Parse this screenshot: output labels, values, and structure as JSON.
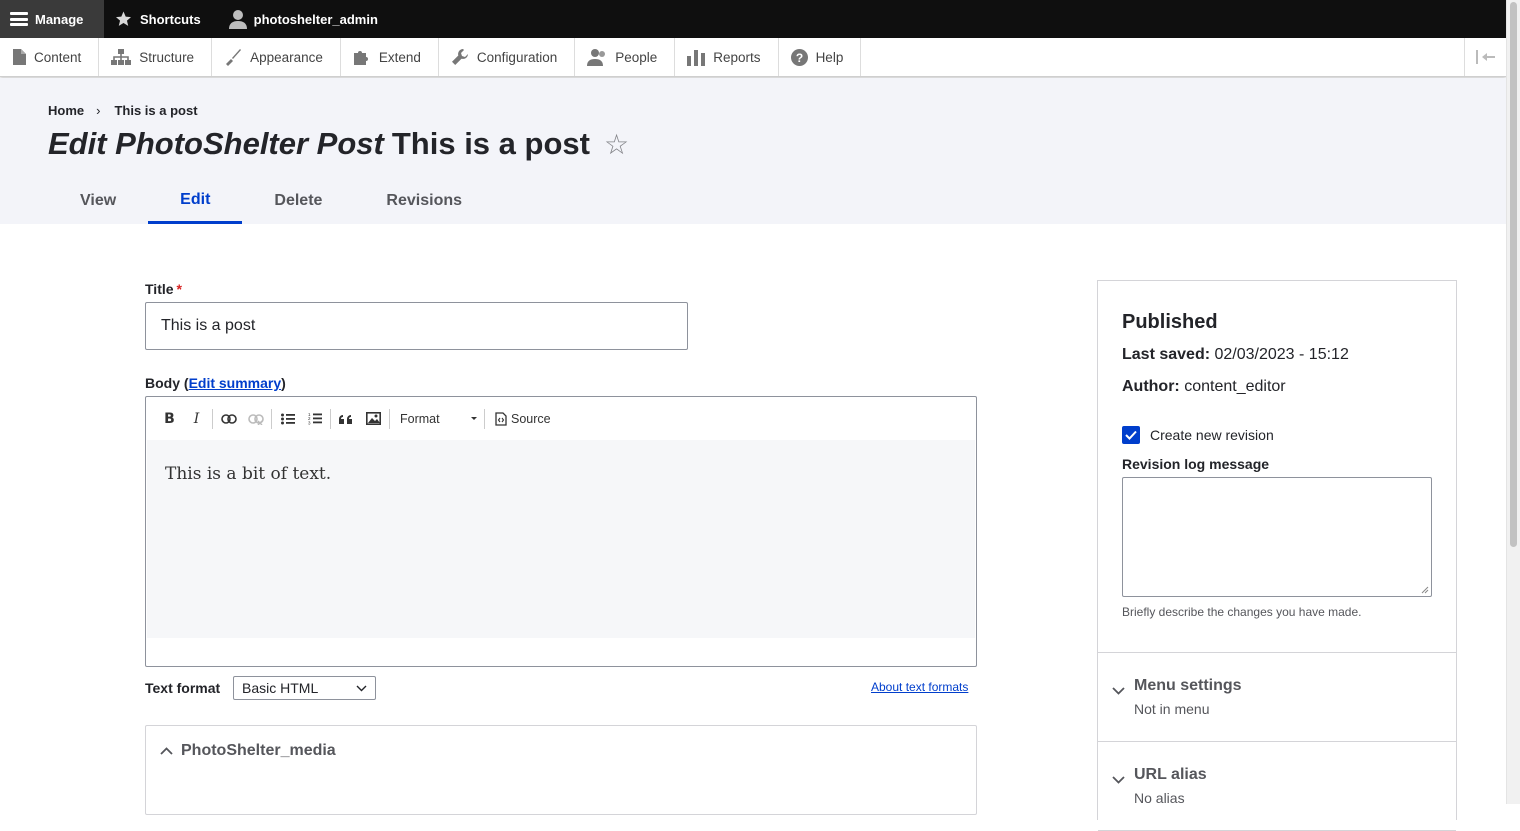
{
  "toolbar": {
    "manage": "Manage",
    "shortcuts": "Shortcuts",
    "user": "photoshelter_admin"
  },
  "tray": [
    {
      "label": "Content",
      "icon": "file-icon"
    },
    {
      "label": "Structure",
      "icon": "sitemap-icon"
    },
    {
      "label": "Appearance",
      "icon": "paintbrush-icon"
    },
    {
      "label": "Extend",
      "icon": "puzzle-icon"
    },
    {
      "label": "Configuration",
      "icon": "wrench-icon"
    },
    {
      "label": "People",
      "icon": "people-icon"
    },
    {
      "label": "Reports",
      "icon": "bar-chart-icon"
    },
    {
      "label": "Help",
      "icon": "help-icon"
    }
  ],
  "breadcrumb": {
    "home": "Home",
    "separator": "›",
    "current": "This is a post"
  },
  "page": {
    "title_em": "Edit PhotoShelter Post",
    "title_rest": "This is a post",
    "star": "☆"
  },
  "tabs": [
    {
      "label": "View"
    },
    {
      "label": "Edit",
      "active": true
    },
    {
      "label": "Delete"
    },
    {
      "label": "Revisions"
    }
  ],
  "form": {
    "title_label": "Title",
    "required_mark": "*",
    "title_value": "This is a post",
    "body_label": "Body",
    "body_paren_open": "(",
    "edit_summary": "Edit summary",
    "body_paren_close": ")",
    "editor": {
      "bold": "B",
      "italic": "I",
      "format_label": "Format",
      "source_label": "Source",
      "content": "This is a bit of text."
    },
    "text_format_label": "Text format",
    "text_format_value": "Basic HTML",
    "about_formats": "About text formats",
    "media_section": "PhotoShelter_media"
  },
  "sidebar": {
    "status": "Published",
    "last_saved_label": "Last saved:",
    "last_saved_value": "02/03/2023 - 15:12",
    "author_label": "Author:",
    "author_value": "content_editor",
    "create_revision": "Create new revision",
    "create_revision_checked": true,
    "revision_log_label": "Revision log message",
    "revision_log_desc": "Briefly describe the changes you have made.",
    "menu_settings_title": "Menu settings",
    "menu_settings_summary": "Not in menu",
    "url_alias_title": "URL alias",
    "url_alias_summary": "No alias"
  },
  "colors": {
    "accent": "#003ecc",
    "toolbar_bg": "#0f0f0f",
    "header_bg": "#f3f4f9",
    "required": "#d72222"
  }
}
